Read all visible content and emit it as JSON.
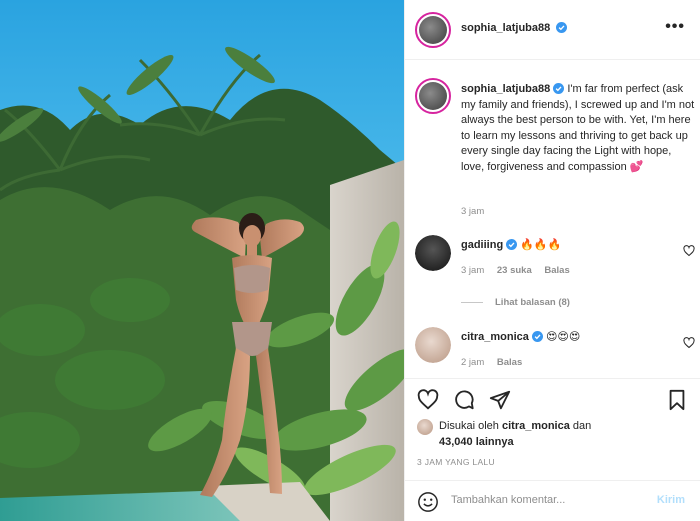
{
  "post": {
    "author": "sophia_latjuba88",
    "more_icon": "more-horizontal-icon",
    "caption": "I'm far from perfect (ask my family and friends), I screwed up and I'm not always the best person to be with. Yet, I'm here to learn my lessons and thriving to get back up every single day facing the Light with hope, love, forgiveness and compassion 💕",
    "caption_time": "3 jam",
    "likes_prefix": "Disukai oleh",
    "likes_user": "citra_monica",
    "likes_and": "dan",
    "likes_count": "43,040 lainnya",
    "posted_ago": "3 JAM YANG LALU"
  },
  "comments": [
    {
      "user": "gadiiing",
      "text": "🔥🔥🔥",
      "time": "3 jam",
      "likes": "23 suka",
      "reply": "Balas",
      "view_replies": "Lihat balasan (8)"
    },
    {
      "user": "citra_monica",
      "text": "😍😍😍",
      "time": "2 jam",
      "reply": "Balas"
    }
  ],
  "composer": {
    "placeholder": "Tambahkan komentar...",
    "send_label": "Kirim"
  },
  "colors": {
    "verified": "#3897f0",
    "meta_text": "#8e8e8e",
    "send_disabled": "#b2dffc",
    "border": "#efefef"
  }
}
